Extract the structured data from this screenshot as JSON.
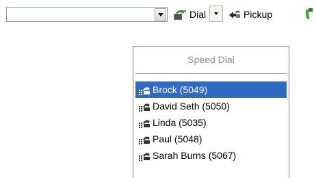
{
  "toolbar": {
    "combo_value": "",
    "dial_label": "Dial",
    "pickup_label": "Pickup"
  },
  "speed_dial_menu": {
    "header": "Speed Dial",
    "items": [
      {
        "label": "Brock (5049)",
        "selected": true
      },
      {
        "label": "David Seth (5050)",
        "selected": false
      },
      {
        "label": "Linda (5035)",
        "selected": false
      },
      {
        "label": "Paul (5048)",
        "selected": false
      },
      {
        "label": "Sarah Burns (5067)",
        "selected": false
      }
    ]
  },
  "colors": {
    "selection": "#316ac5",
    "combo_border": "#7f9db9",
    "header_text": "#8c8c8c"
  },
  "icons": {
    "dial": "phone-dial-icon",
    "pickup": "pickup-icon",
    "speed_dial_entry": "speed-dial-phone-icon",
    "cut_off_right": "green-phone-icon"
  }
}
